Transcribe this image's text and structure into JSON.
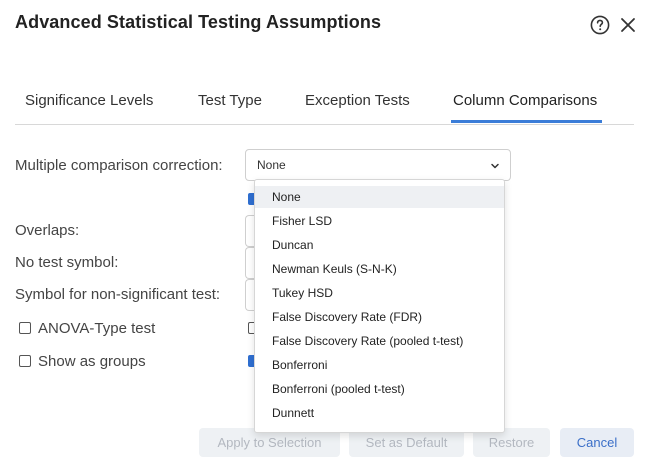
{
  "dialog": {
    "title": "Advanced Statistical Testing Assumptions"
  },
  "icons": {
    "help": "help-circle-icon",
    "close": "close-x-icon",
    "chevron": "chevron-down-icon"
  },
  "tabs": [
    {
      "label": "Significance Levels",
      "active": false
    },
    {
      "label": "Test Type",
      "active": false
    },
    {
      "label": "Exception Tests",
      "active": false
    },
    {
      "label": "Column Comparisons",
      "active": true
    }
  ],
  "form": {
    "correction_label": "Multiple comparison correction:",
    "correction_value": "None",
    "overlaps_label": "Overlaps:",
    "no_test_symbol_label": "No test symbol:",
    "non_sig_symbol_label": "Symbol for non-significant test:",
    "anova_label": "ANOVA-Type test",
    "anova_checked": false,
    "show_groups_label": "Show as groups",
    "show_groups_checked": false
  },
  "dropdown": {
    "options": [
      "None",
      "Fisher LSD",
      "Duncan",
      "Newman Keuls (S-N-K)",
      "Tukey HSD",
      "False Discovery Rate (FDR)",
      "False Discovery Rate (pooled t-test)",
      "Bonferroni",
      "Bonferroni (pooled t-test)",
      "Dunnett"
    ],
    "selected": "None"
  },
  "footer": {
    "apply_label": "Apply to Selection",
    "default_label": "Set as Default",
    "restore_label": "Restore",
    "cancel_label": "Cancel"
  },
  "colors": {
    "accent": "#3b7dd8",
    "checkbox_checked": "#2f6fd1",
    "disabled_bg": "#eef1f4",
    "disabled_text": "#b3b8c0",
    "cancel_text": "#3b6fc8"
  }
}
